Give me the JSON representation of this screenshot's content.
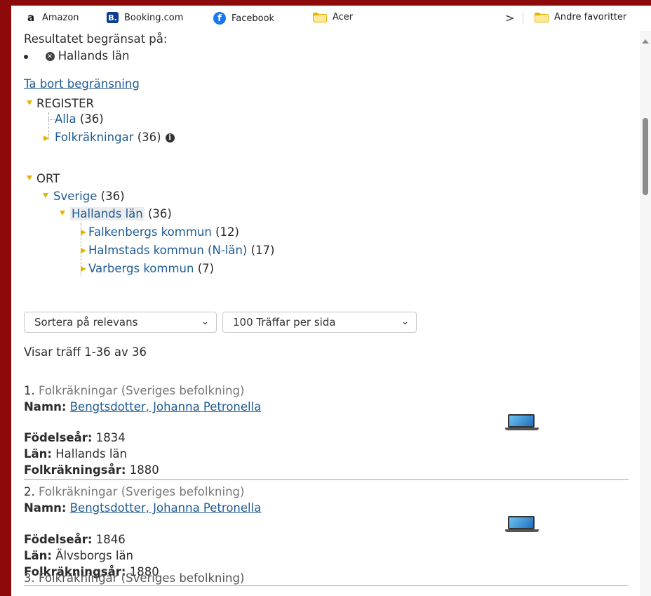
{
  "bookmarks": {
    "items": [
      {
        "label": "Amazon",
        "icon": "amazon-icon",
        "glyph": "a"
      },
      {
        "label": "Booking.com",
        "icon": "booking-icon",
        "glyph": "B."
      },
      {
        "label": "Facebook",
        "icon": "facebook-icon",
        "glyph": "f"
      },
      {
        "label": "Acer",
        "icon": "folder-icon",
        "glyph": ""
      }
    ],
    "overflow_glyph": ">",
    "other_favorites": "Andre favoritter"
  },
  "filter": {
    "heading": "Resultatet begränsat på:",
    "active": "Hallands län",
    "remove_link": "Ta bort begränsning"
  },
  "register": {
    "title": "REGISTER",
    "items": [
      {
        "label": "Alla",
        "count": "(36)"
      },
      {
        "label": "Folkräkningar",
        "count": "(36)"
      }
    ]
  },
  "ort": {
    "title": "ORT",
    "country": {
      "label": "Sverige",
      "count": "(36)"
    },
    "county": {
      "label": "Hallands län",
      "count": "(36)"
    },
    "municipalities": [
      {
        "label": "Falkenbergs kommun",
        "count": "(12)"
      },
      {
        "label": "Halmstads kommun (N-län)",
        "count": "(17)"
      },
      {
        "label": "Varbergs kommun",
        "count": "(7)"
      }
    ]
  },
  "controls": {
    "sort_selected": "Sortera på relevans",
    "per_page_selected": "100 Träffar per sida"
  },
  "results_summary": "Visar träff 1-36 av 36",
  "results": [
    {
      "index": "1.",
      "source": "Folkräkningar (Sveriges befolkning)",
      "name_label": "Namn:",
      "name": "Bengtsdotter, Johanna Petronella",
      "birth_label": "Födelseår:",
      "birth": "1834",
      "county_label": "Län:",
      "county": "Hallands län",
      "census_label": "Folkräkningsår:",
      "census": "1880"
    },
    {
      "index": "2.",
      "source": "Folkräkningar (Sveriges befolkning)",
      "name_label": "Namn:",
      "name": "Bengtsdotter, Johanna Petronella",
      "birth_label": "Födelseår:",
      "birth": "1846",
      "county_label": "Län:",
      "county": "Älvsborgs län",
      "census_label": "Folkräkningsår:",
      "census": "1880"
    }
  ],
  "partial_next": "3. Folkräkningar (Sveriges befolkning)"
}
